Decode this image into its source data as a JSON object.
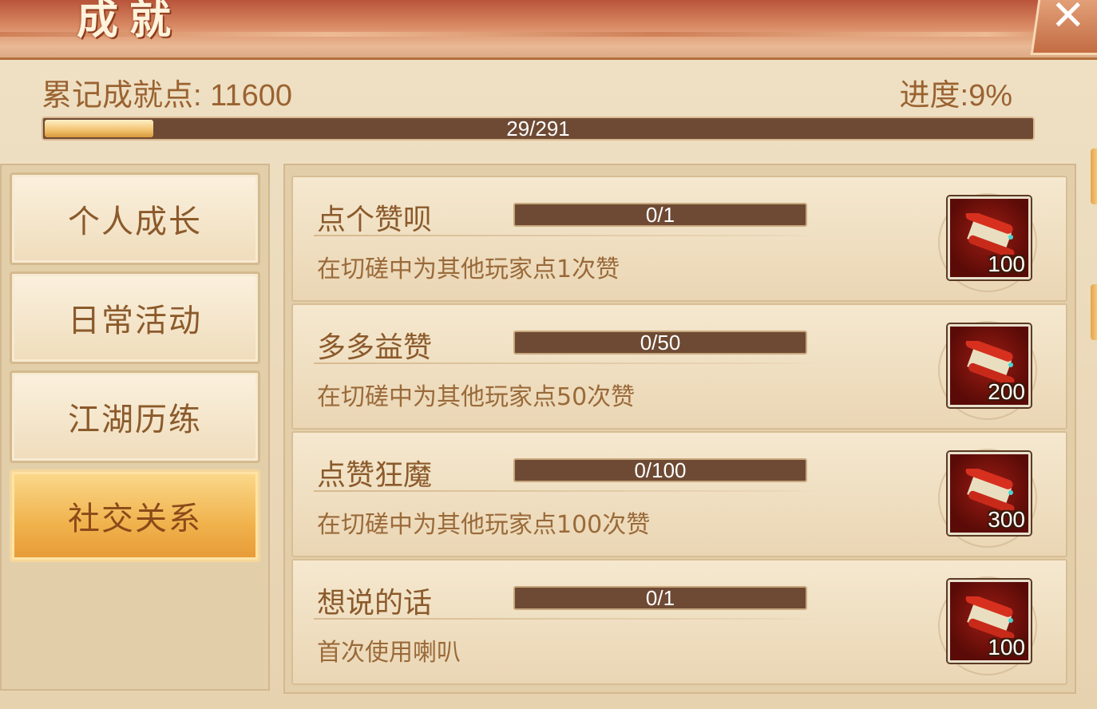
{
  "header": {
    "title": "成就",
    "close_icon": "close-icon",
    "total_points_label": "累记成就点: 11600",
    "progress_label": "进度:9%",
    "progress_text": "29/291",
    "progress_fraction": 0.09
  },
  "sidebar": {
    "tabs": [
      {
        "label": "个人成长",
        "active": false
      },
      {
        "label": "日常活动",
        "active": false
      },
      {
        "label": "江湖历练",
        "active": false
      },
      {
        "label": "社交关系",
        "active": true
      }
    ]
  },
  "achievements": [
    {
      "title": "点个赞呗",
      "progress": "0/1",
      "description": "在切磋中为其他玩家点1次赞",
      "reward_icon": "scroll-icon",
      "reward_count": "100"
    },
    {
      "title": "多多益赞",
      "progress": "0/50",
      "description": "在切磋中为其他玩家点50次赞",
      "reward_icon": "scroll-icon",
      "reward_count": "200"
    },
    {
      "title": "点赞狂魔",
      "progress": "0/100",
      "description": "在切磋中为其他玩家点100次赞",
      "reward_icon": "scroll-icon",
      "reward_count": "300"
    },
    {
      "title": "想说的话",
      "progress": "0/1",
      "description": "首次使用喇叭",
      "reward_icon": "scroll-icon",
      "reward_count": "100"
    }
  ],
  "colors": {
    "accent": "#f0b24c",
    "text_brown": "#8b5a2b",
    "bar_dark": "#6e4a34"
  }
}
